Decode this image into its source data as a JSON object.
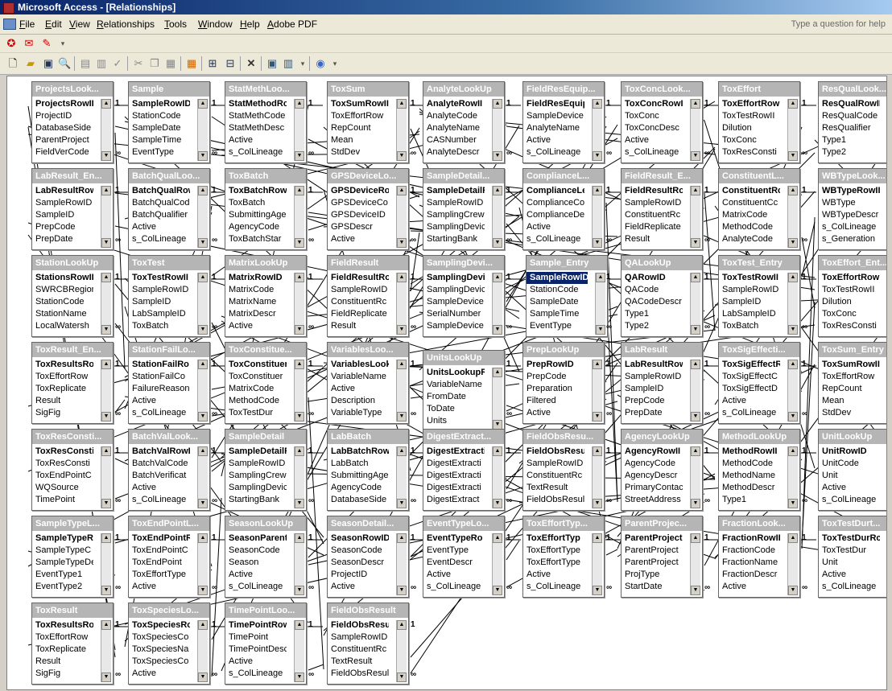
{
  "window": {
    "title": "Microsoft Access - [Relationships]"
  },
  "menu": {
    "items": [
      "File",
      "Edit",
      "View",
      "Relationships",
      "Tools",
      "Window",
      "Help",
      "Adobe PDF"
    ],
    "help_box": "Type a question for help"
  },
  "icons": {
    "toolbar1": [
      "pdf-convert-icon",
      "pdf-email-icon",
      "pdf-review-icon"
    ],
    "toolbar2": [
      "new-icon",
      "open-icon",
      "save-icon",
      "print-preview-icon",
      "print-icon",
      "spelling-icon",
      "cut-icon",
      "copy-icon",
      "paste-icon",
      "show-table-icon",
      "show-direct-icon",
      "show-all-icon",
      "delete-icon",
      "new-object-icon",
      "help-icon"
    ]
  },
  "tables": [
    {
      "name": "ProjectsLook...",
      "fields": [
        "ProjectsRowII",
        "ProjectID",
        "DatabaseSide",
        "ParentProject",
        "FieldVerCode"
      ]
    },
    {
      "name": "Sample",
      "fields": [
        "SampleRowID",
        "StationCode",
        "SampleDate",
        "SampleTime",
        "EventType"
      ]
    },
    {
      "name": "StatMethLoo...",
      "fields": [
        "StatMethodRc",
        "StatMethCode",
        "StatMethDesc",
        "Active",
        "s_ColLineage"
      ]
    },
    {
      "name": "ToxSum",
      "fields": [
        "ToxSumRowII",
        "ToxEffortRow",
        "RepCount",
        "Mean",
        "StdDev"
      ]
    },
    {
      "name": "AnalyteLookUp",
      "fields": [
        "AnalyteRowII",
        "AnalyteCode",
        "AnalyteName",
        "CASNumber",
        "AnalyteDescr"
      ]
    },
    {
      "name": "FieldResEquip...",
      "fields": [
        "FieldResEquip",
        "SampleDevice",
        "AnalyteName",
        "Active",
        "s_ColLineage"
      ]
    },
    {
      "name": "ToxConcLook...",
      "fields": [
        "ToxConcRowI",
        "ToxConc",
        "ToxConcDesc",
        "Active",
        "s_ColLineage"
      ]
    },
    {
      "name": "ToxEffort",
      "fields": [
        "ToxEffortRow",
        "ToxTestRowII",
        "Dilution",
        "ToxConc",
        "ToxResConsti"
      ]
    },
    {
      "name": "ResQualLook...",
      "fields": [
        "ResQualRowII",
        "ResQualCode",
        "ResQualifier",
        "Type1",
        "Type2"
      ]
    },
    {
      "name": "LabResult_En...",
      "fields": [
        "LabResultRow",
        "SampleRowID",
        "SampleID",
        "PrepCode",
        "PrepDate"
      ]
    },
    {
      "name": "BatchQualLoo...",
      "fields": [
        "BatchQualRow",
        "BatchQualCod",
        "BatchQualifier",
        "Active",
        "s_ColLineage"
      ]
    },
    {
      "name": "ToxBatch",
      "fields": [
        "ToxBatchRow",
        "ToxBatch",
        "SubmittingAge",
        "AgencyCode",
        "ToxBatchStar"
      ]
    },
    {
      "name": "GPSDeviceLo...",
      "fields": [
        "GPSDeviceRo",
        "GPSDeviceCo",
        "GPSDeviceID",
        "GPSDescr",
        "Active"
      ]
    },
    {
      "name": "SampleDetail...",
      "fields": [
        "SampleDetailR",
        "SampleRowID",
        "SamplingCrew",
        "SamplingDevic",
        "StartingBank"
      ]
    },
    {
      "name": "ComplianceL...",
      "fields": [
        "ComplianceLe",
        "ComplianceCo",
        "ComplianceDe",
        "Active",
        "s_ColLineage"
      ]
    },
    {
      "name": "FieldResult_E...",
      "fields": [
        "FieldResultRo",
        "SampleRowID",
        "ConstituentRc",
        "FieldReplicate",
        "Result"
      ]
    },
    {
      "name": "ConstituentL...",
      "fields": [
        "ConstituentRc",
        "ConstituentCc",
        "MatrixCode",
        "MethodCode",
        "AnalyteCode"
      ]
    },
    {
      "name": "WBTypeLook...",
      "fields": [
        "WBTypeRowII",
        "WBType",
        "WBTypeDescr",
        "s_ColLineage",
        "s_Generation"
      ]
    },
    {
      "name": "StationLookUp",
      "fields": [
        "StationsRowII",
        "SWRCBRegion",
        "StationCode",
        "StationName",
        "LocalWatersh"
      ]
    },
    {
      "name": "ToxTest",
      "fields": [
        "ToxTestRowII",
        "SampleRowID",
        "SampleID",
        "LabSampleID",
        "ToxBatch"
      ]
    },
    {
      "name": "MatrixLookUp",
      "fields": [
        "MatrixRowID",
        "MatrixCode",
        "MatrixName",
        "MatrixDescr",
        "Active"
      ]
    },
    {
      "name": "FieldResult",
      "fields": [
        "FieldResultRo",
        "SampleRowID",
        "ConstituentRc",
        "FieldReplicate",
        "Result"
      ]
    },
    {
      "name": "SamplingDevi...",
      "fields": [
        "SamplingDevic",
        "SamplingDevic",
        "SampleDevice",
        "SerialNumber",
        "SampleDevice"
      ]
    },
    {
      "name": "Sample_Entry",
      "fields": [
        "SampleRowID",
        "StationCode",
        "SampleDate",
        "SampleTime",
        "EventType"
      ]
    },
    {
      "name": "QALookUp",
      "fields": [
        "QARowID",
        "QACode",
        "QACodeDescr",
        "Type1",
        "Type2"
      ]
    },
    {
      "name": "ToxTest_Entry",
      "fields": [
        "ToxTestRowII",
        "SampleRowID",
        "SampleID",
        "LabSampleID",
        "ToxBatch"
      ]
    },
    {
      "name": "ToxEffort_Ent...",
      "fields": [
        "ToxEffortRow",
        "ToxTestRowII",
        "Dilution",
        "ToxConc",
        "ToxResConsti"
      ]
    },
    {
      "name": "ToxResult_En...",
      "fields": [
        "ToxResultsRo",
        "ToxEffortRow",
        "ToxReplicate",
        "Result",
        "SigFig"
      ]
    },
    {
      "name": "StationFailLo...",
      "fields": [
        "StationFailRo",
        "StationFailCo",
        "FailureReason",
        "Active",
        "s_ColLineage"
      ]
    },
    {
      "name": "ToxConstitue...",
      "fields": [
        "ToxConstituer",
        "ToxConstituer",
        "MatrixCode",
        "MethodCode",
        "ToxTestDur"
      ]
    },
    {
      "name": "VariablesLoo...",
      "fields": [
        "VariablesLook",
        "VariableName",
        "Active",
        "Description",
        "VariableType"
      ]
    },
    {
      "name": "UnitsLookUp",
      "fields": [
        "UnitsLookupR",
        "VariableName",
        "FromDate",
        "ToDate",
        "Units"
      ]
    },
    {
      "name": "PrepLookUp",
      "fields": [
        "PrepRowID",
        "PrepCode",
        "Preparation",
        "Filtered",
        "Active"
      ]
    },
    {
      "name": "LabResult",
      "fields": [
        "LabResultRow",
        "SampleRowID",
        "SampleID",
        "PrepCode",
        "PrepDate"
      ]
    },
    {
      "name": "ToxSigEffecti...",
      "fields": [
        "ToxSigEffectR",
        "ToxSigEffectC",
        "ToxSigEffectD",
        "Active",
        "s_ColLineage"
      ]
    },
    {
      "name": "ToxSum_Entry",
      "fields": [
        "ToxSumRowII",
        "ToxEffortRow",
        "RepCount",
        "Mean",
        "StdDev"
      ]
    },
    {
      "name": "ToxResConsti...",
      "fields": [
        "ToxResConsti",
        "ToxResConsti",
        "ToxEndPointC",
        "WQSource",
        "TimePoint"
      ]
    },
    {
      "name": "BatchValLook...",
      "fields": [
        "BatchValRowI",
        "BatchValCode",
        "BatchVerificat",
        "Active",
        "s_ColLineage"
      ]
    },
    {
      "name": "SampleDetail",
      "fields": [
        "SampleDetailR",
        "SampleRowID",
        "SamplingCrew",
        "SamplingDevic",
        "StartingBank"
      ]
    },
    {
      "name": "LabBatch",
      "fields": [
        "LabBatchRow",
        "LabBatch",
        "SubmittingAge",
        "AgencyCode",
        "DatabaseSide"
      ]
    },
    {
      "name": "DigestExtract...",
      "fields": [
        "DigestExtracti",
        "DigestExtracti",
        "DigestExtracti",
        "DigestExtracti",
        "DigestExtract"
      ]
    },
    {
      "name": "FieldObsResu...",
      "fields": [
        "FieldObsResul",
        "SampleRowID",
        "ConstituentRc",
        "TextResult",
        "FieldObsResul"
      ]
    },
    {
      "name": "AgencyLookUp",
      "fields": [
        "AgencyRowII",
        "AgencyCode",
        "AgencyDescr",
        "PrimaryContac",
        "StreetAddress"
      ]
    },
    {
      "name": "MethodLookUp",
      "fields": [
        "MethodRowII",
        "MethodCode",
        "MethodName",
        "MethodDescr",
        "Type1"
      ]
    },
    {
      "name": "UnitLookUp",
      "fields": [
        "UnitRowID",
        "UnitCode",
        "Unit",
        "Active",
        "s_ColLineage"
      ]
    },
    {
      "name": "SampleTypeL...",
      "fields": [
        "SampleTypeR",
        "SampleTypeC",
        "SampleTypeDe",
        "EventType1",
        "EventType2"
      ]
    },
    {
      "name": "ToxEndPointL...",
      "fields": [
        "ToxEndPointR",
        "ToxEndPointC",
        "ToxEndPoint",
        "ToxEffortType",
        "Active"
      ]
    },
    {
      "name": "SeasonLookUp",
      "fields": [
        "SeasonParent",
        "SeasonCode",
        "Season",
        "Active",
        "s_ColLineage"
      ]
    },
    {
      "name": "SeasonDetail...",
      "fields": [
        "SeasonRowID",
        "SeasonCode",
        "SeasonDescr",
        "ProjectID",
        "Active"
      ]
    },
    {
      "name": "EventTypeLo...",
      "fields": [
        "EventTypeRo",
        "EventType",
        "EventDescr",
        "Active",
        "s_ColLineage"
      ]
    },
    {
      "name": "ToxEffortTyp...",
      "fields": [
        "ToxEffortTyp",
        "ToxEffortType",
        "ToxEffortType",
        "Active",
        "s_ColLineage"
      ]
    },
    {
      "name": "ParentProjec...",
      "fields": [
        "ParentProject",
        "ParentProject",
        "ParentProject",
        "ProjType",
        "StartDate"
      ]
    },
    {
      "name": "FractionLook...",
      "fields": [
        "FractionRowII",
        "FractionCode",
        "FractionName",
        "FractionDescr",
        "Active"
      ]
    },
    {
      "name": "ToxTestDurt...",
      "fields": [
        "ToxTestDurRc",
        "ToxTestDur",
        "Unit",
        "Active",
        "s_ColLineage"
      ]
    },
    {
      "name": "ToxResult",
      "fields": [
        "ToxResultsRo",
        "ToxEffortRow",
        "ToxReplicate",
        "Result",
        "SigFig"
      ]
    },
    {
      "name": "ToxSpeciesLo...",
      "fields": [
        "ToxSpeciesRo",
        "ToxSpeciesCo",
        "ToxSpeciesNa",
        "ToxSpeciesCo",
        "Active"
      ]
    },
    {
      "name": "TimePointLoo...",
      "fields": [
        "TimePointRow",
        "TimePoint",
        "TimePointDesc",
        "Active",
        "s_ColLineage"
      ]
    },
    {
      "name": "FieldObsResult",
      "fields": [
        "FieldObsResu",
        "SampleRowID",
        "ConstituentRc",
        "TextResult",
        "FieldObsResul"
      ]
    }
  ],
  "cardinality_labels": {
    "one": "1",
    "many": "∞"
  },
  "colors": {
    "table_header": "#b5b5b5",
    "canvas": "#ffffff",
    "chrome": "#ece9d8",
    "titlebar": "#0a246a"
  }
}
